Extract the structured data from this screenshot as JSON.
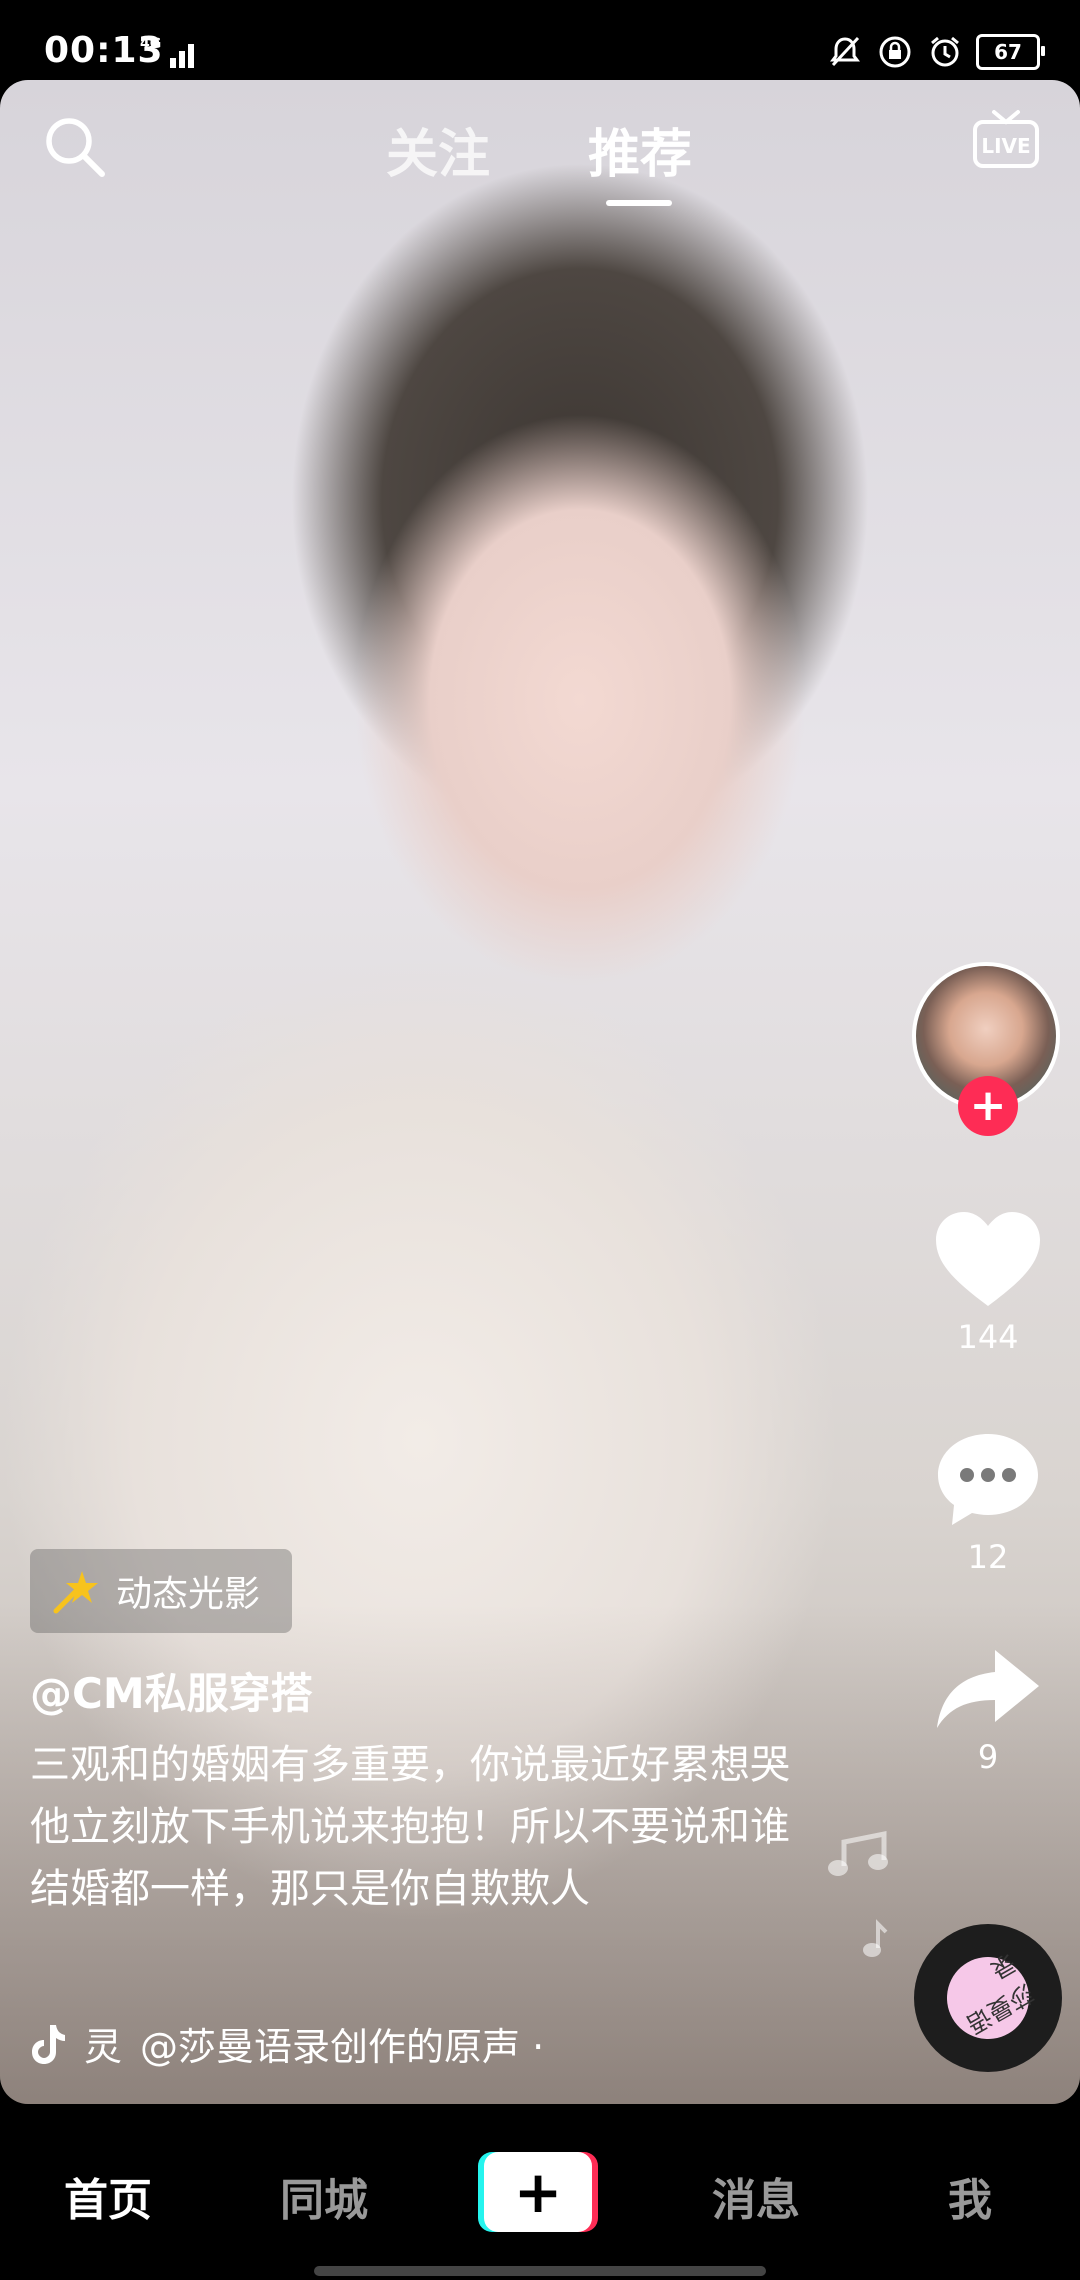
{
  "status_bar": {
    "time": "00:13",
    "network": "4G",
    "battery": "67"
  },
  "top_nav": {
    "tabs": [
      {
        "label": "关注",
        "active": false
      },
      {
        "label": "推荐",
        "active": true
      }
    ],
    "live_label": "LIVE"
  },
  "right_rail": {
    "likes": "144",
    "comments": "12",
    "shares": "9"
  },
  "caption": {
    "effect_tag": "动态光影",
    "author": "@CM私服穿搭",
    "text": "三观和的婚姻有多重要，你说最近好累想哭他立刻放下手机说来抱抱！所以不要说和谁结婚都一样，那只是你自欺欺人",
    "music_prefix": "灵",
    "music": "@莎曼语录创作的原声 ·"
  },
  "disc_text": "莎曼语录",
  "bottom_nav": {
    "home": "首页",
    "city": "同城",
    "create": "+",
    "messages": "消息",
    "me": "我"
  },
  "colors": {
    "accent_red": "#fe2c55",
    "accent_cyan": "#25f4ee"
  }
}
